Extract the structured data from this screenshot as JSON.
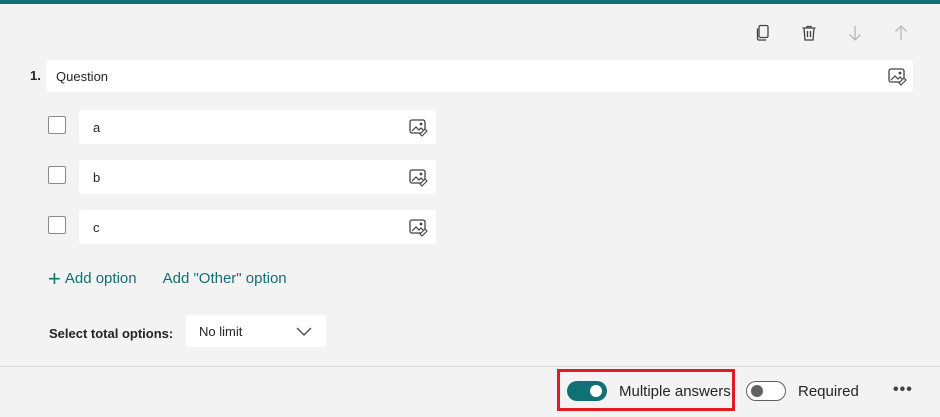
{
  "accent_color": "#0f7173",
  "highlight_color": "#e21b23",
  "toolbar": {
    "copy_icon": "copy-icon",
    "delete_icon": "trash-icon",
    "move_down_icon": "arrow-down-icon",
    "move_up_icon": "arrow-up-icon"
  },
  "question": {
    "number": "1.",
    "text": "Question",
    "options": [
      {
        "label": "a",
        "checked": false
      },
      {
        "label": "b",
        "checked": false
      },
      {
        "label": "c",
        "checked": false
      }
    ]
  },
  "actions": {
    "add_option_icon": "+",
    "add_option": "Add option",
    "add_other": "Add \"Other\" option"
  },
  "total_options": {
    "label": "Select total options:",
    "value": "No limit"
  },
  "footer": {
    "multiple_answers": {
      "label": "Multiple answers",
      "enabled": true
    },
    "required": {
      "label": "Required",
      "enabled": false
    },
    "more": "•••"
  }
}
